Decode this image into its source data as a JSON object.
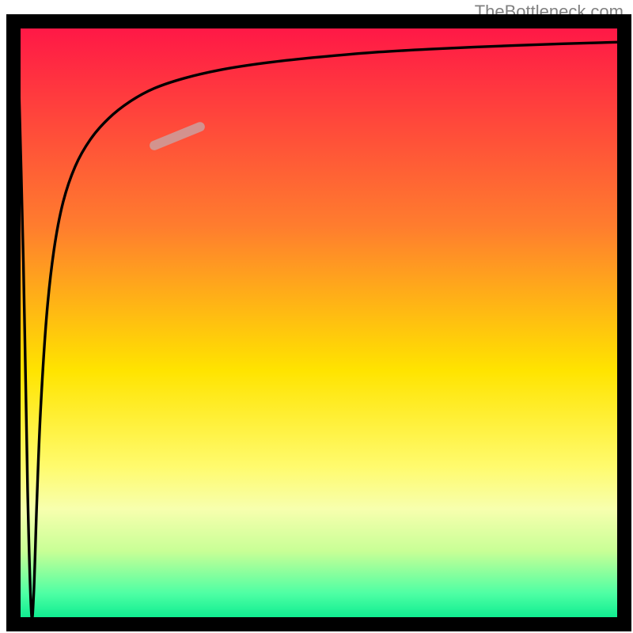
{
  "attribution": "TheBottleneck.com",
  "chart_data": {
    "type": "line",
    "title": "",
    "xlabel": "",
    "ylabel": "",
    "x_range": [
      0,
      100
    ],
    "y_range": [
      0,
      100
    ],
    "axes_visible": false,
    "grid": false,
    "background": {
      "type": "vertical_gradient",
      "description": "Background gradient from red (top) through orange and yellow to green (bottom), depicting severity from bad (top) to good (bottom).",
      "stops": [
        {
          "pos": 0.0,
          "color": "#ff1547"
        },
        {
          "pos": 0.34,
          "color": "#ff7d2e"
        },
        {
          "pos": 0.58,
          "color": "#ffe400"
        },
        {
          "pos": 0.74,
          "color": "#fffb6e"
        },
        {
          "pos": 0.81,
          "color": "#f7ffae"
        },
        {
          "pos": 0.88,
          "color": "#c8ff96"
        },
        {
          "pos": 0.95,
          "color": "#4effa4"
        },
        {
          "pos": 1.0,
          "color": "#00e88c"
        }
      ]
    },
    "comment": "X = hardware performance index, Y = bottleneck percentage. Optimal point near very low X where bottleneck reaches ~0%; curve rises steeply and asymptotes near ~97% for high X.",
    "series": [
      {
        "name": "bottleneck_curve",
        "color": "#000000",
        "stroke_width": 3.4,
        "x": [
          0.5,
          1.5,
          2.2,
          2.8,
          3.2,
          3.7,
          4.3,
          5.3,
          6.5,
          8.0,
          10.0,
          12.5,
          15.5,
          19.0,
          23.0,
          28.0,
          34.0,
          41.0,
          49.0,
          58.0,
          68.0,
          79.0,
          90.0,
          100.0
        ],
        "y": [
          99.7,
          60.0,
          22.0,
          2.0,
          5.0,
          20.0,
          35.0,
          51.0,
          62.0,
          70.0,
          76.0,
          80.5,
          84.0,
          86.8,
          89.0,
          90.7,
          92.1,
          93.2,
          94.1,
          94.9,
          95.5,
          96.0,
          96.4,
          96.7
        ]
      },
      {
        "name": "highlight_segment",
        "type": "segment_marker",
        "color": "#caa2a2",
        "opacity": 0.82,
        "stroke_width": 12,
        "x": [
          23.0,
          30.5
        ],
        "y": [
          79.5,
          82.6
        ]
      }
    ]
  },
  "frame": {
    "outer": 800,
    "inset_left": 18,
    "inset_top": 28,
    "inset_right": 12,
    "inset_bottom": 12,
    "stroke_width": 18,
    "color": "#000000"
  }
}
